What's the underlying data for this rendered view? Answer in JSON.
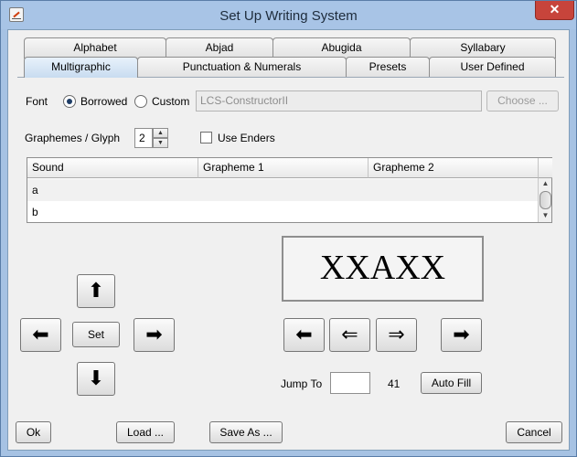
{
  "window": {
    "title": "Set Up Writing System",
    "close_symbol": "✕"
  },
  "tabs_row1": [
    {
      "label": "Alphabet"
    },
    {
      "label": "Abjad"
    },
    {
      "label": "Abugida"
    },
    {
      "label": "Syllabary"
    }
  ],
  "tabs_row2": [
    {
      "label": "Multigraphic",
      "selected": true
    },
    {
      "label": "Punctuation & Numerals"
    },
    {
      "label": "Presets"
    },
    {
      "label": "User Defined"
    }
  ],
  "font": {
    "label": "Font",
    "borrowed_label": "Borrowed",
    "custom_label": "Custom",
    "selected": "Borrowed",
    "font_name": "LCS-ConstructorII",
    "choose_label": "Choose ..."
  },
  "graphemes": {
    "label": "Graphemes / Glyph",
    "value": "2",
    "use_enders_label": "Use Enders",
    "use_enders_checked": false
  },
  "table": {
    "columns": [
      "Sound",
      "Grapheme 1",
      "Grapheme 2"
    ],
    "rows": [
      [
        "a",
        "",
        ""
      ],
      [
        "b",
        "",
        ""
      ]
    ]
  },
  "nav_pad": {
    "up_symbol": "⬆",
    "down_symbol": "⬇",
    "left_symbol": "⬅",
    "right_symbol": "➡",
    "set_label": "Set"
  },
  "preview": {
    "text": "XXAXX",
    "first_symbol": "⬅",
    "prev_symbol": "⇐",
    "next_symbol": "⇒",
    "last_symbol": "➡"
  },
  "jump": {
    "label": "Jump To",
    "value": "",
    "count": "41",
    "autofill_label": "Auto Fill"
  },
  "footer": {
    "ok_label": "Ok",
    "load_label": "Load ...",
    "save_label": "Save As ...",
    "cancel_label": "Cancel"
  }
}
